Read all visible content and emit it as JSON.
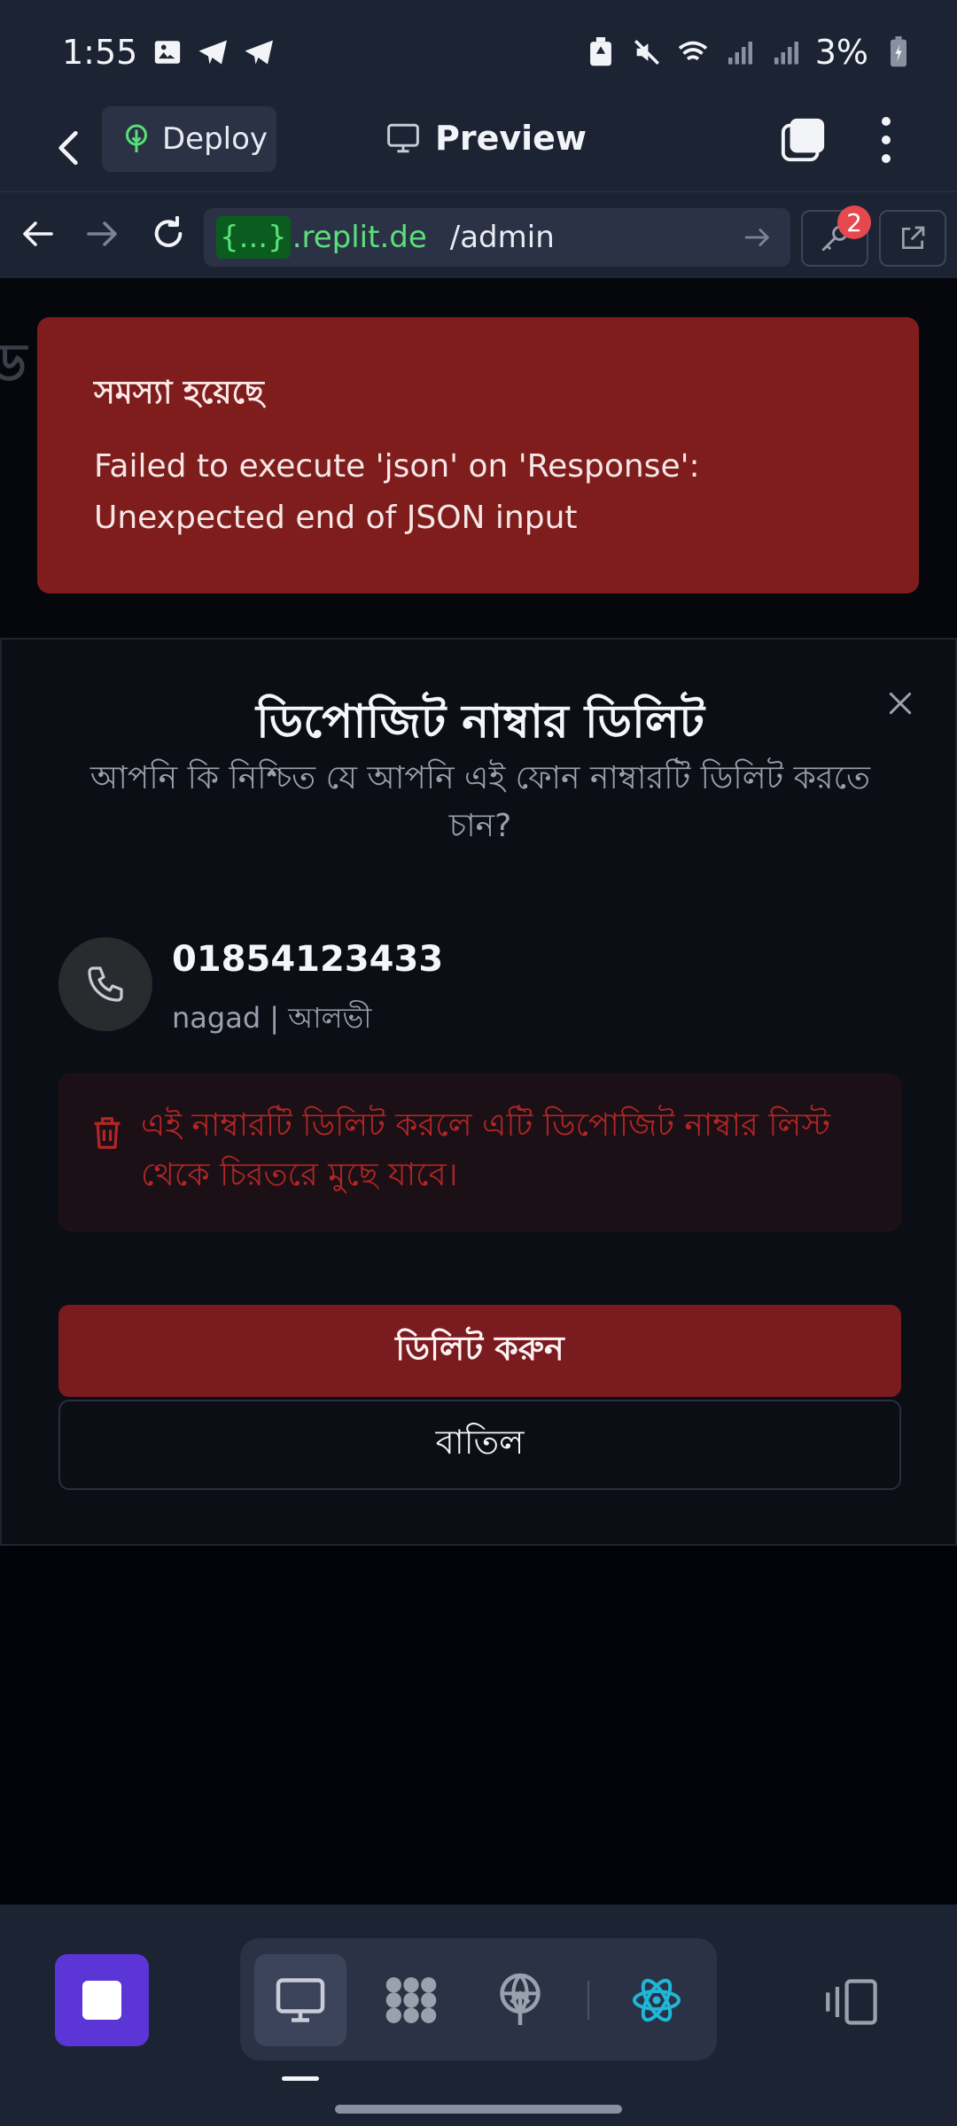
{
  "status_bar": {
    "time": "1:55",
    "battery": "3%"
  },
  "header": {
    "deploy_label": "Deploy",
    "preview_label": "Preview"
  },
  "url_bar": {
    "chip": "{...}",
    "host": ".replit.de",
    "path": "/admin",
    "badge_count": "2"
  },
  "toast": {
    "title": "সমস্যা হয়েছে",
    "message_line1": "Failed to execute 'json' on 'Response':",
    "message_line2": "Unexpected end of JSON input"
  },
  "modal": {
    "title": "ডিপোজিট নাম্বার ডিলিট",
    "subtitle": "আপনি কি নিশ্চিত যে আপনি এই ফোন নাম্বারটি ডিলিট করতে চান?",
    "phone_number": "01854123433",
    "phone_meta": "nagad | আলভী",
    "warning": "এই নাম্বারটি ডিলিট করলে এটি ডিপোজিট নাম্বার লিস্ট থেকে চিরতরে মুছে যাবে।",
    "delete_label": "ডিলিট করুন",
    "cancel_label": "বাতিল"
  },
  "colors": {
    "accent_purple": "#5b35d5",
    "error_red": "#7f1d1d",
    "url_green": "#5ae07a",
    "react_cyan": "#1fb6d8"
  },
  "icons": [
    "image-icon",
    "telegram-icon",
    "battery-saver-icon",
    "mute-icon",
    "wifi-icon",
    "signal-icon",
    "battery-icon",
    "back-icon",
    "deploy-icon",
    "monitor-icon",
    "tabs-icon",
    "more-icon",
    "arrow-left-icon",
    "arrow-right-icon",
    "reload-icon",
    "key-icon",
    "external-link-icon",
    "close-icon",
    "phone-icon",
    "trash-icon",
    "stop-icon",
    "desktop-icon",
    "agent-icon",
    "deployments-icon",
    "react-icon",
    "panels-icon"
  ]
}
